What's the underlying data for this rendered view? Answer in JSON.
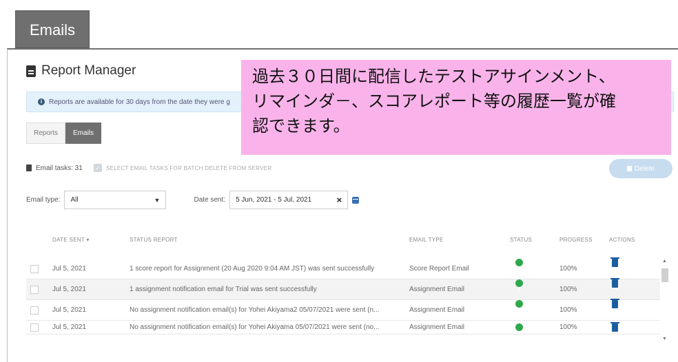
{
  "page_tab": "Emails",
  "title": "Report Manager",
  "info": "Reports are available for 30 days from the date they were g",
  "tabs": [
    {
      "label": "Reports",
      "active": false
    },
    {
      "label": "Emails",
      "active": true
    }
  ],
  "callout": {
    "line1": "過去３０日間に配信したテストアサインメント、",
    "line2": "リマインダ－、スコアレポート等の履歴一覧が確",
    "line3": "認できます。",
    "color": "#f9b3ea"
  },
  "tasks": {
    "label": "Email tasks: 31",
    "batch_label": "SELECT EMAIL TASKS FOR BATCH DELETE FROM SERVER"
  },
  "delete_button": "Delete",
  "filters": {
    "email_type_label": "Email type:",
    "email_type_value": "All",
    "date_sent_label": "Date sent:",
    "date_sent_value": "5 Jun, 2021 - 5 Jul, 2021"
  },
  "columns": {
    "date_sent": "DATE SENT ▾",
    "status_report": "STATUS REPORT",
    "email_type": "EMAIL TYPE",
    "status": "STATUS",
    "progress": "PROGRESS",
    "actions": "ACTIONS"
  },
  "rows": [
    {
      "date": "Jul 5, 2021",
      "report": "1 score report for Assignment (20 Aug 2020 9:04 AM JST) was sent successfully",
      "type": "Score Report Email",
      "progress": "100%"
    },
    {
      "date": "Jul 5, 2021",
      "report": "1 assignment notification email for Trial was sent successfully",
      "type": "Assignment Email",
      "progress": "100%"
    },
    {
      "date": "Jul 5, 2021",
      "report": "No assignment notification email(s) for Yohei Akiyama2 05/07/2021 were sent (n...",
      "type": "Assignment Email",
      "progress": "100%"
    },
    {
      "date": "Jul 5, 2021",
      "report": "No assignment notification email(s) for Yohei Akiyama 05/07/2021 were sent (no...",
      "type": "Assignment Email",
      "progress": "100%"
    }
  ],
  "colors": {
    "status_ok": "#2ea84a",
    "trash": "#1b5e9e",
    "tab_dark": "#6f6f6f"
  }
}
